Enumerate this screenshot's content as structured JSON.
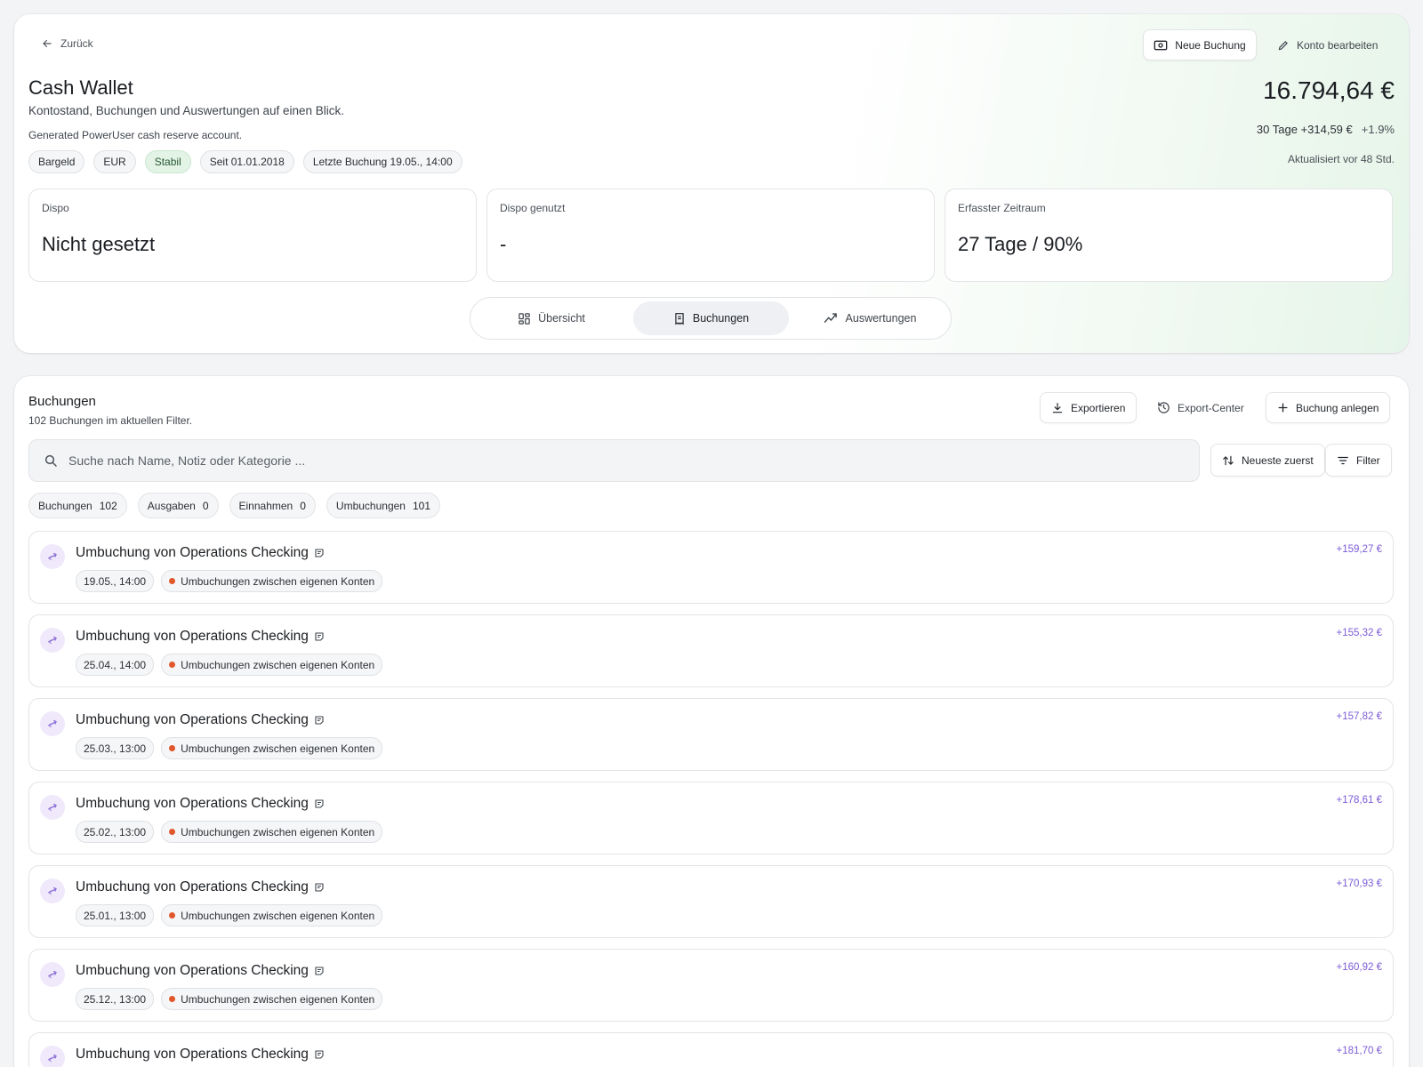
{
  "header": {
    "back_label": "Zurück",
    "title": "Cash Wallet",
    "subtitle": "Kontostand, Buchungen und Auswertungen auf einen Blick.",
    "description": "Generated PowerUser cash reserve account.",
    "chips": [
      "Bargeld",
      "EUR",
      "Stabil",
      "Seit 01.01.2018",
      "Letzte Buchung 19.05., 14:00"
    ],
    "new_booking_label": "Neue Buchung",
    "edit_account_label": "Konto bearbeiten",
    "balance": "16.794,64 €",
    "delta_label": "30 Tage +314,59 €",
    "delta_pct": "+1.9%",
    "updated": "Aktualisiert vor 48 Std."
  },
  "stats": [
    {
      "label": "Dispo",
      "value": "Nicht gesetzt"
    },
    {
      "label": "Dispo genutzt",
      "value": "-"
    },
    {
      "label": "Erfasster Zeitraum",
      "value": "27 Tage / 90%"
    }
  ],
  "tabs": [
    {
      "label": "Übersicht",
      "icon": "grid-icon"
    },
    {
      "label": "Buchungen",
      "icon": "receipt-icon"
    },
    {
      "label": "Auswertungen",
      "icon": "trend-icon"
    }
  ],
  "active_tab": "Buchungen",
  "bookings": {
    "title": "Buchungen",
    "subtitle": "102 Buchungen im aktuellen Filter.",
    "export_label": "Exportieren",
    "export_center_label": "Export-Center",
    "add_label": "Buchung anlegen",
    "search_placeholder": "Suche nach Name, Notiz oder Kategorie ...",
    "sort_label": "Neueste zuerst",
    "filter_label": "Filter",
    "filter_chips": [
      {
        "label": "Buchungen",
        "count": "102"
      },
      {
        "label": "Ausgaben",
        "count": "0"
      },
      {
        "label": "Einnahmen",
        "count": "0"
      },
      {
        "label": "Umbuchungen",
        "count": "101"
      }
    ],
    "rows": [
      {
        "title": "Umbuchung von Operations Checking",
        "date": "19.05., 14:00",
        "category": "Umbuchungen zwischen eigenen Konten",
        "amount": "+159,27 €"
      },
      {
        "title": "Umbuchung von Operations Checking",
        "date": "25.04., 14:00",
        "category": "Umbuchungen zwischen eigenen Konten",
        "amount": "+155,32 €"
      },
      {
        "title": "Umbuchung von Operations Checking",
        "date": "25.03., 13:00",
        "category": "Umbuchungen zwischen eigenen Konten",
        "amount": "+157,82 €"
      },
      {
        "title": "Umbuchung von Operations Checking",
        "date": "25.02., 13:00",
        "category": "Umbuchungen zwischen eigenen Konten",
        "amount": "+178,61 €"
      },
      {
        "title": "Umbuchung von Operations Checking",
        "date": "25.01., 13:00",
        "category": "Umbuchungen zwischen eigenen Konten",
        "amount": "+170,93 €"
      },
      {
        "title": "Umbuchung von Operations Checking",
        "date": "25.12., 13:00",
        "category": "Umbuchungen zwischen eigenen Konten",
        "amount": "+160,92 €"
      },
      {
        "title": "Umbuchung von Operations Checking",
        "date": "",
        "category": "",
        "amount": "+181,70 €"
      }
    ]
  },
  "colors": {
    "accent_green": "#e3f3e6",
    "transfer_icon_bg": "#efe9fb",
    "transfer_icon": "#8b6fd6",
    "amount_positive": "#7c5cd6",
    "category_dot": "#e0572b"
  }
}
